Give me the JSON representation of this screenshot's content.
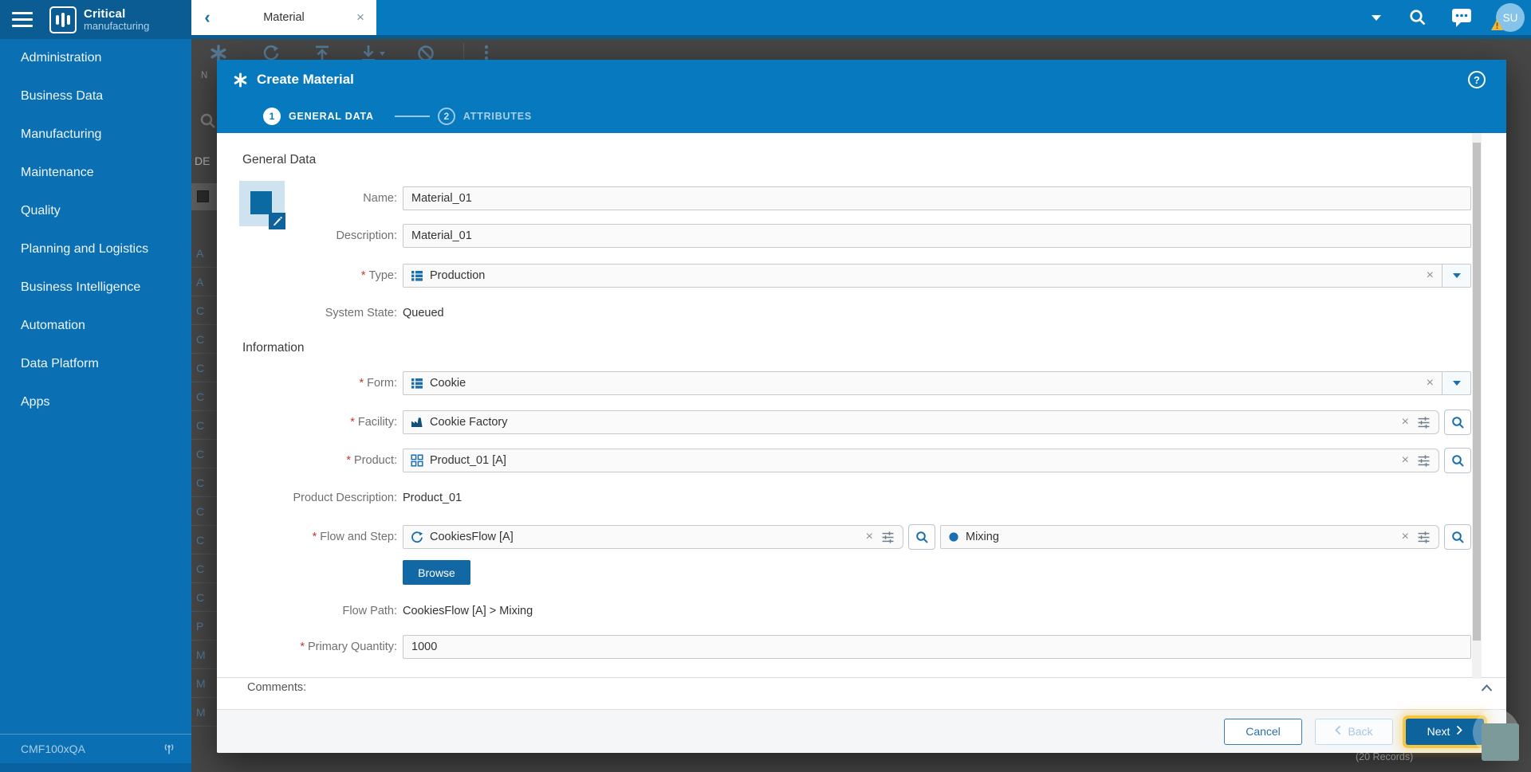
{
  "topbar": {
    "brand": {
      "title": "Critical",
      "subtitle": "manufacturing"
    },
    "tab": {
      "label": "Material"
    },
    "user": {
      "initials": "SU"
    }
  },
  "icons": {
    "tab_back": "‹",
    "tab_close": "×",
    "clear": "×",
    "help": "?"
  },
  "sidebar": {
    "items": [
      "Administration",
      "Business Data",
      "Manufacturing",
      "Maintenance",
      "Quality",
      "Planning and Logistics",
      "Business Intelligence",
      "Automation",
      "Data Platform",
      "Apps"
    ],
    "footer": {
      "environment": "CMF100xQA"
    }
  },
  "background": {
    "toolbar_label_partial": "N",
    "panel_label_partial": "DE",
    "row_letters": [
      "A",
      "A",
      "C",
      "C",
      "C",
      "C",
      "C",
      "C",
      "C",
      "C",
      "C",
      "C",
      "C",
      "P",
      "M",
      "M",
      "M"
    ],
    "records_label": "(20 Records)"
  },
  "modal": {
    "title": "Create Material",
    "required_marker": "*",
    "steps": [
      {
        "number": "1",
        "label": "GENERAL DATA"
      },
      {
        "number": "2",
        "label": "ATTRIBUTES"
      }
    ],
    "sections": {
      "general": "General Data",
      "information": "Information"
    },
    "fields": {
      "name": {
        "label": "Name:",
        "value": "Material_01"
      },
      "description": {
        "label": "Description:",
        "value": "Material_01"
      },
      "type": {
        "label": "Type:",
        "value": "Production"
      },
      "system_state": {
        "label": "System State:",
        "value": "Queued"
      },
      "form": {
        "label": "Form:",
        "value": "Cookie"
      },
      "facility": {
        "label": "Facility:",
        "value": "Cookie Factory"
      },
      "product": {
        "label": "Product:",
        "value": "Product_01 [A]"
      },
      "product_description": {
        "label": "Product Description:",
        "value": "Product_01"
      },
      "flow_and_step": {
        "label": "Flow and Step:",
        "flow_value": "CookiesFlow [A]",
        "step_value": "Mixing"
      },
      "flow_path": {
        "label": "Flow Path:",
        "value": "CookiesFlow [A] > Mixing"
      },
      "primary_quantity": {
        "label": "Primary Quantity:",
        "value": "1000"
      },
      "comments": {
        "label": "Comments:"
      }
    },
    "buttons": {
      "browse": "Browse",
      "cancel": "Cancel",
      "back": "Back",
      "next": "Next"
    }
  },
  "colors": {
    "topbar": "#0679bf",
    "topbar_dark": "#0b5c92",
    "sidebar": "#0b6fb3",
    "accent": "#1a6fae",
    "primary_button": "#0d639c",
    "focus_ring": "#f4c542",
    "required": "#c03b2b"
  }
}
